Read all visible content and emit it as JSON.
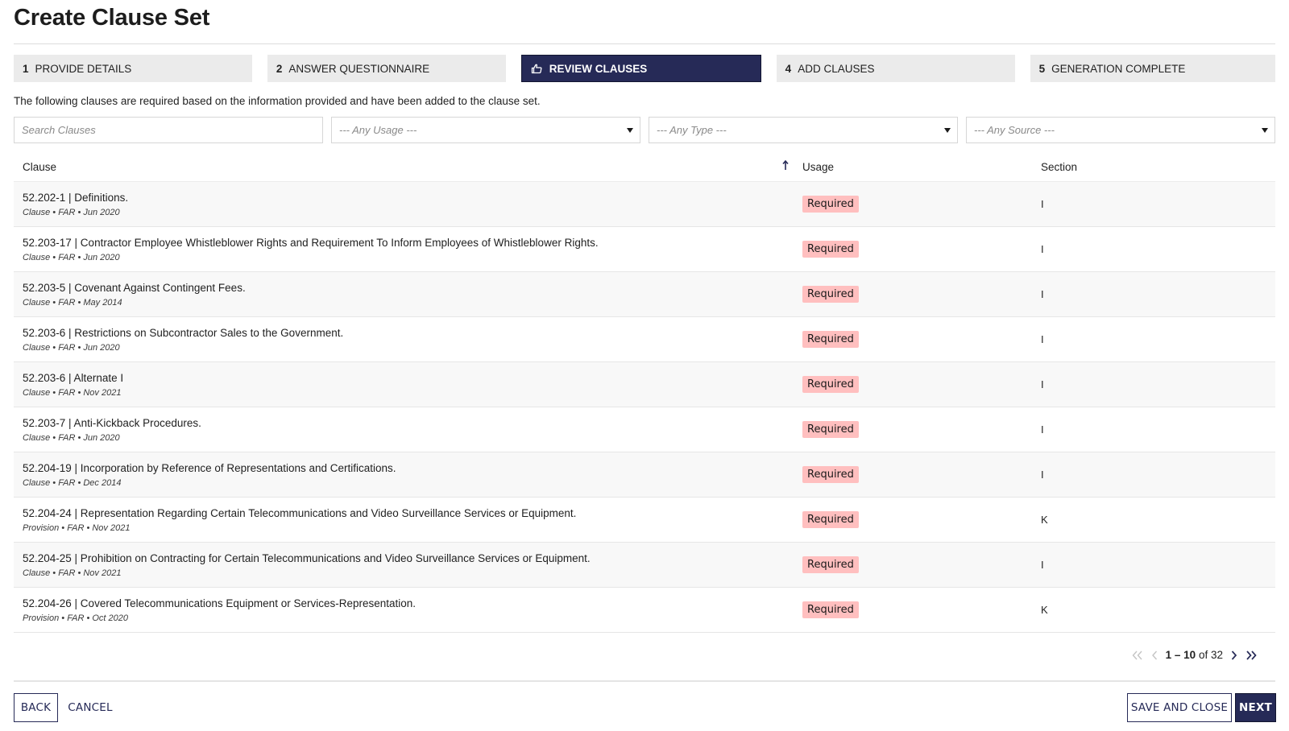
{
  "page": {
    "title": "Create Clause Set"
  },
  "steps": [
    {
      "number": "1",
      "label": "PROVIDE DETAILS",
      "state": "inactive"
    },
    {
      "number": "2",
      "label": "ANSWER QUESTIONNAIRE",
      "state": "inactive"
    },
    {
      "number": "3",
      "label": "REVIEW CLAUSES",
      "state": "active",
      "icon": "hand-pointer-icon"
    },
    {
      "number": "4",
      "label": "ADD CLAUSES",
      "state": "inactive"
    },
    {
      "number": "5",
      "label": "GENERATION COMPLETE",
      "state": "inactive"
    }
  ],
  "info_text": "The following clauses are required based on the information provided and have been added to the clause set.",
  "filters": {
    "search_placeholder": "Search Clauses",
    "search_value": "",
    "usage_selected": "--- Any Usage ---",
    "type_selected": "--- Any Type ---",
    "source_selected": "--- Any Source ---"
  },
  "table": {
    "columns": {
      "clause": "Clause",
      "usage": "Usage",
      "section": "Section"
    },
    "sort": {
      "column": "usage",
      "direction": "ascending",
      "icon": "arrow-up-icon"
    },
    "rows": [
      {
        "title": "52.202-1 | Definitions.",
        "meta": "Clause • FAR • Jun 2020",
        "usage": "Required",
        "section": "I"
      },
      {
        "title": "52.203-17 | Contractor Employee Whistleblower Rights and Requirement To Inform Employees of Whistleblower Rights.",
        "meta": "Clause • FAR • Jun 2020",
        "usage": "Required",
        "section": "I"
      },
      {
        "title": "52.203-5 | Covenant Against Contingent Fees.",
        "meta": "Clause • FAR • May 2014",
        "usage": "Required",
        "section": "I"
      },
      {
        "title": "52.203-6 | Restrictions on Subcontractor Sales to the Government.",
        "meta": "Clause • FAR • Jun 2020",
        "usage": "Required",
        "section": "I"
      },
      {
        "title": "52.203-6 | Alternate I",
        "meta": "Clause • FAR • Nov 2021",
        "usage": "Required",
        "section": "I"
      },
      {
        "title": "52.203-7 | Anti-Kickback Procedures.",
        "meta": "Clause • FAR • Jun 2020",
        "usage": "Required",
        "section": "I"
      },
      {
        "title": "52.204-19 | Incorporation by Reference of Representations and Certifications.",
        "meta": "Clause • FAR • Dec 2014",
        "usage": "Required",
        "section": "I"
      },
      {
        "title": "52.204-24 | Representation Regarding Certain Telecommunications and Video Surveillance Services or Equipment.",
        "meta": "Provision • FAR • Nov 2021",
        "usage": "Required",
        "section": "K"
      },
      {
        "title": "52.204-25 | Prohibition on Contracting for Certain Telecommunications and Video Surveillance Services or Equipment.",
        "meta": "Clause • FAR • Nov 2021",
        "usage": "Required",
        "section": "I"
      },
      {
        "title": "52.204-26 | Covered Telecommunications Equipment or Services-Representation.",
        "meta": "Provision • FAR • Oct 2020",
        "usage": "Required",
        "section": "K"
      }
    ]
  },
  "pagination": {
    "range": "1 – 10",
    "of_label": "of",
    "total": "32",
    "first_enabled": false,
    "prev_enabled": false,
    "next_enabled": true,
    "last_enabled": true
  },
  "footer": {
    "back_label": "BACK",
    "cancel_label": "CANCEL",
    "save_close_label": "SAVE AND CLOSE",
    "next_label": "NEXT"
  },
  "colors": {
    "primary": "#262a57",
    "step_inactive_bg": "#ebebeb",
    "badge_required_bg": "#ffbfbf",
    "row_alt_bg": "#f8f8f8",
    "pager_disabled": "#c4c4c4"
  }
}
